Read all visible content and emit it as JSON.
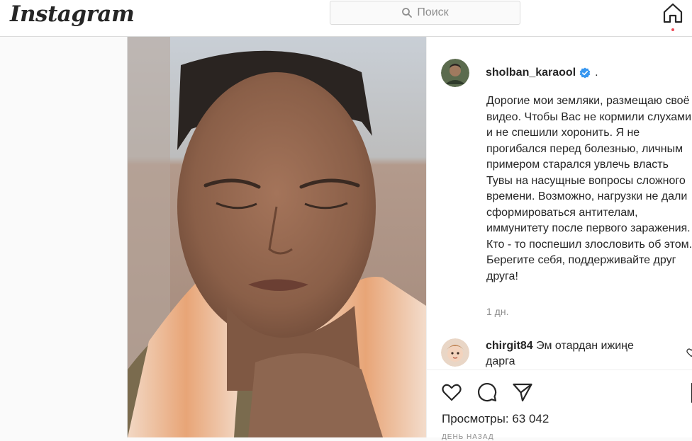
{
  "header": {
    "logo_text": "Instagram",
    "search_placeholder": "Поиск",
    "icons": [
      "search-icon",
      "home-icon"
    ]
  },
  "post": {
    "author": {
      "username": "sholban_karaool",
      "verified": true,
      "separator": "."
    },
    "caption": "Дорогие мои земляки, размещаю своё видео. Чтобы Вас не кормили слухами и не спешили хоронить. Я не прогибался перед болезнью, личным примером старался увлечь власть Тувы на насущные вопросы сложного времени. Возможно, нагрузки не дали сформироваться антителам, иммунитету после первого заражения. Кто - то поспешил злословить об этом. Берегите себя, поддерживайте друг друга!",
    "time_ago": "1 дн.",
    "comments": [
      {
        "username": "chirgit84",
        "text": "Эм отардан ижиңе дарга"
      }
    ],
    "actions": [
      "heart-icon",
      "comment-icon",
      "share-icon",
      "bookmark-icon"
    ],
    "views_label": "Просмотры:",
    "views_count": "63 042",
    "date_cut": "ДЕНЬ НАЗАД"
  },
  "colors": {
    "border": "#dbdbdb",
    "text": "#262626",
    "muted": "#8e8e8e",
    "verified": "#3897f0",
    "notification": "#ed4956"
  }
}
